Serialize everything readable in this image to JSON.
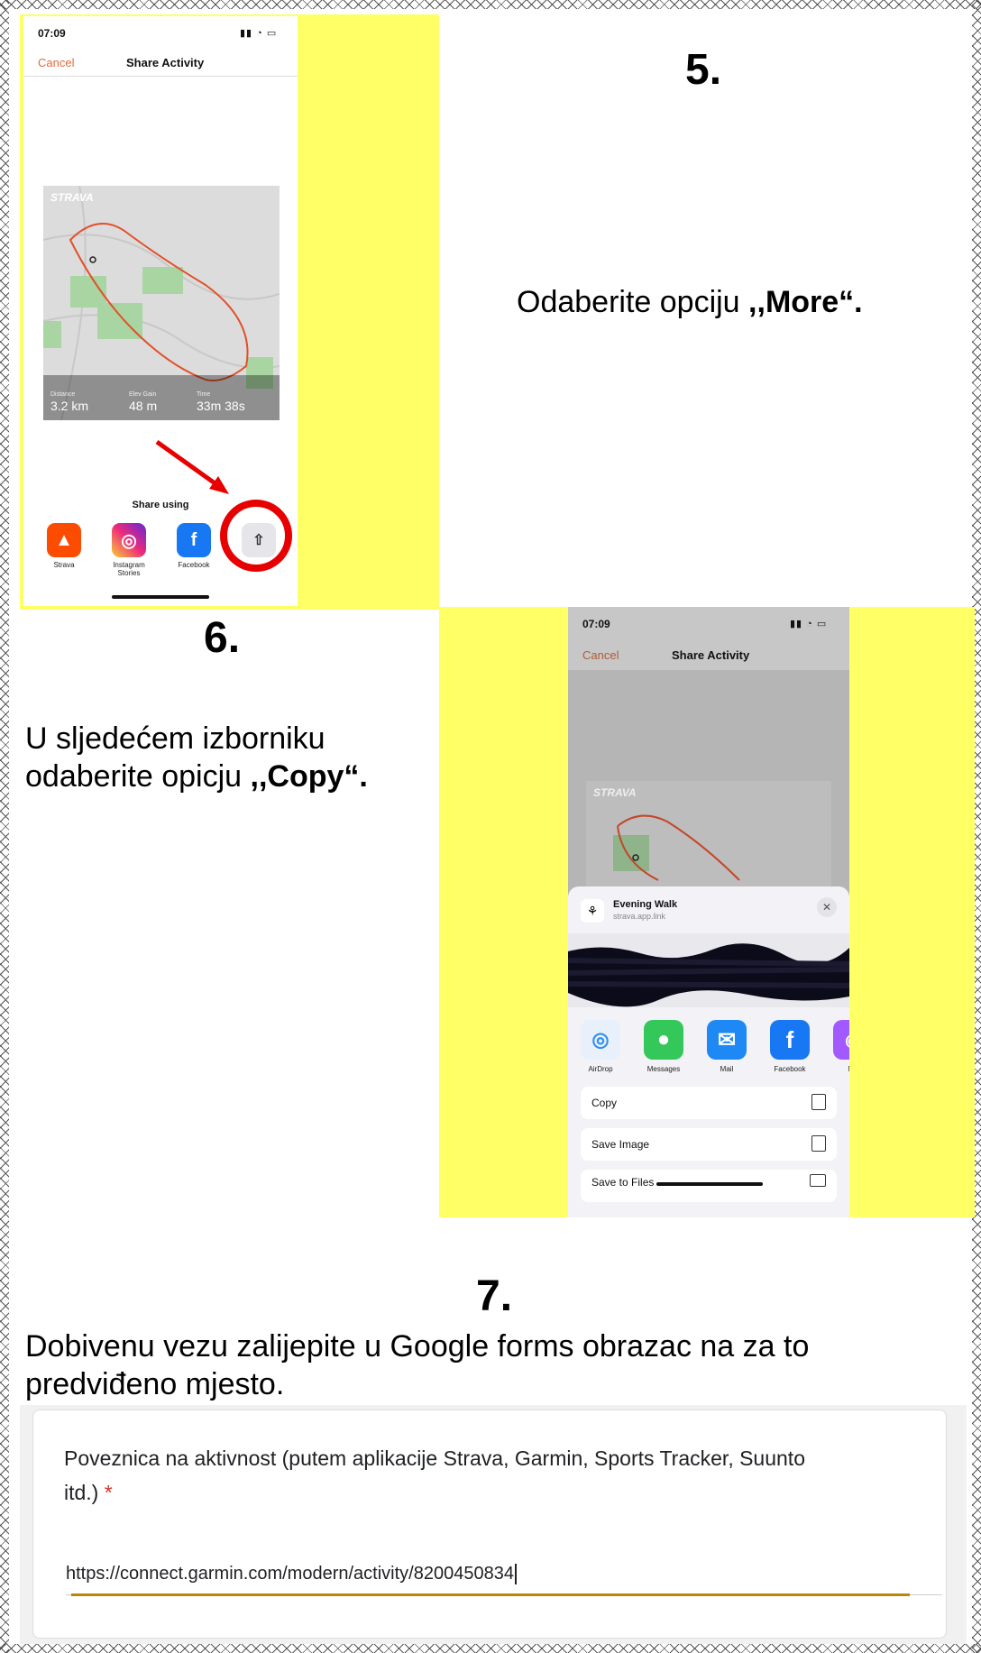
{
  "step5": {
    "number": "5.",
    "instruction_pre": "Odaberite opciju ",
    "instruction_bold": ",,More“."
  },
  "step6": {
    "number": "6.",
    "instruction_line1": "U sljedećem izborniku",
    "instruction_line2_pre": "odaberite opicju ",
    "instruction_bold": ",,Copy“."
  },
  "step7": {
    "number": "7.",
    "instruction_line1": "Dobivenu vezu zalijepite u Google forms obrazac na za to",
    "instruction_line2": "predviđeno mjesto."
  },
  "phone1": {
    "time": "07:09",
    "cancel": "Cancel",
    "title": "Share Activity",
    "strava_logo": "STRAVA",
    "stats": [
      {
        "label": "Distance",
        "value": "3.2 km"
      },
      {
        "label": "Elev Gain",
        "value": "48 m"
      },
      {
        "label": "Time",
        "value": "33m 38s"
      }
    ],
    "share_using": "Share using",
    "apps": [
      {
        "label": "Strava",
        "color": "#fc4c02",
        "icon": "strava-icon"
      },
      {
        "label": "Instagram Stories",
        "color": "#c13584",
        "icon": "instagram-icon"
      },
      {
        "label": "Facebook",
        "color": "#1877f2",
        "icon": "facebook-icon"
      },
      {
        "label": "More",
        "color": "#e5e5ea",
        "icon": "share-icon"
      }
    ],
    "highlight_color": "#e60000"
  },
  "phone2": {
    "time": "07:09",
    "cancel": "Cancel",
    "title": "Share Activity",
    "strava_logo": "STRAVA",
    "link_title": "Evening Walk",
    "link_url": "strava.app.link",
    "apps": [
      {
        "label": "AirDrop",
        "icon": "airdrop-icon"
      },
      {
        "label": "Messages",
        "icon": "messages-icon"
      },
      {
        "label": "Mail",
        "icon": "mail-icon"
      },
      {
        "label": "Facebook",
        "icon": "facebook-icon"
      },
      {
        "label": "Me",
        "icon": "messenger-icon"
      }
    ],
    "actions": [
      {
        "label": "Copy",
        "icon": "copy-icon"
      },
      {
        "label": "Save Image",
        "icon": "save-image-icon"
      },
      {
        "label": "Save to Files",
        "icon": "folder-icon"
      }
    ]
  },
  "google_form": {
    "question_line1": "Poveznica na aktivnost (putem aplikacije Strava, Garmin, Sports Tracker, Suunto",
    "question_line2": "itd.)",
    "required_mark": "*",
    "answer": "https://connect.garmin.com/modern/activity/8200450834"
  }
}
